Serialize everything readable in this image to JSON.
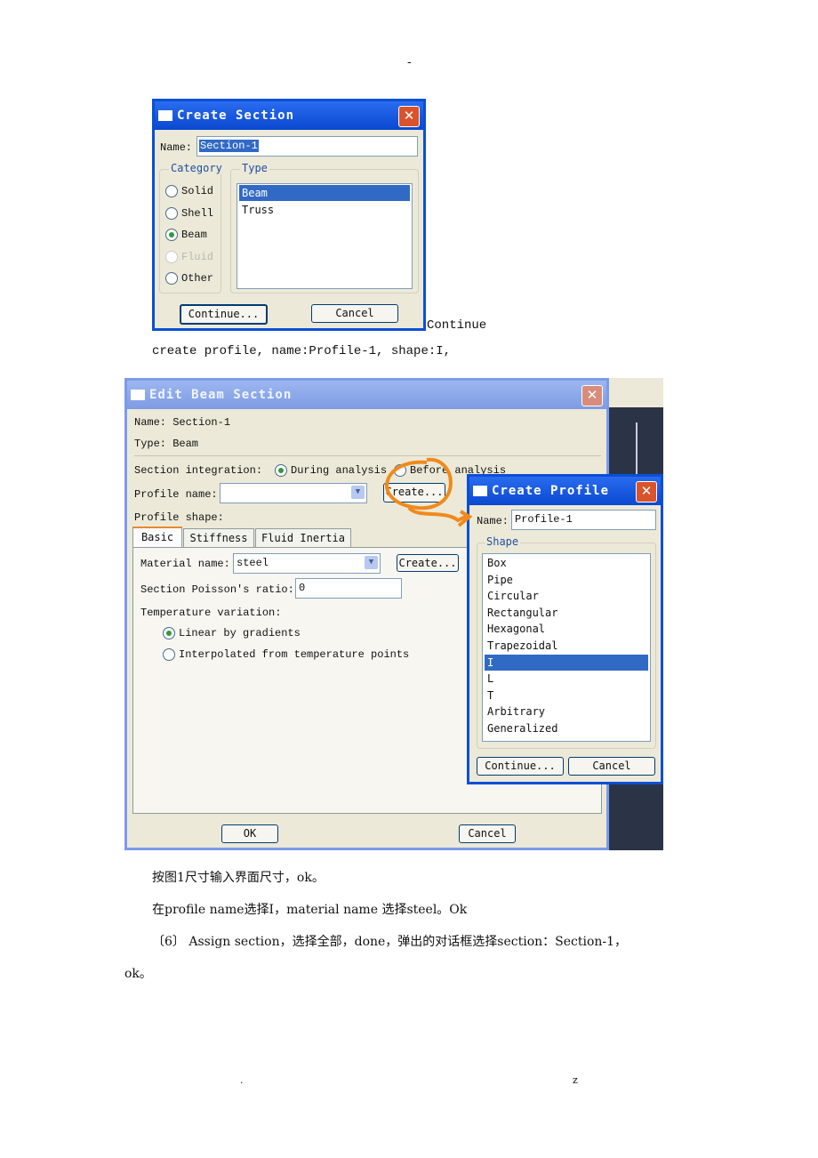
{
  "header": {
    "mark": "-"
  },
  "create_section": {
    "title": "Create Section",
    "name_label": "Name:",
    "name_value": "Section-1",
    "category_label": "Category",
    "categories": [
      {
        "label": "Solid",
        "selected": false,
        "enabled": true
      },
      {
        "label": "Shell",
        "selected": false,
        "enabled": true
      },
      {
        "label": "Beam",
        "selected": true,
        "enabled": true
      },
      {
        "label": "Fluid",
        "selected": false,
        "enabled": false
      },
      {
        "label": "Other",
        "selected": false,
        "enabled": true
      }
    ],
    "type_label": "Type",
    "types": [
      {
        "label": "Beam",
        "selected": true
      },
      {
        "label": "Truss",
        "selected": false
      }
    ],
    "continue_label": "Continue...",
    "cancel_label": "Cancel",
    "close_icon": "close-icon"
  },
  "caption_continue": "Continue",
  "line_create_profile": "create profile, name:Profile-1, shape:I,",
  "edit_beam": {
    "title": "Edit Beam Section",
    "name_line": "Name:  Section-1",
    "type_line": "Type:  Beam",
    "integration_label": "Section integration:",
    "integration_options": [
      {
        "label": "During analysis",
        "selected": true
      },
      {
        "label": "Before analysis",
        "selected": false
      }
    ],
    "profile_name_label": "Profile name:",
    "profile_name_value": "",
    "create_label": "Create...",
    "profile_shape_label": "Profile shape:",
    "tabs": [
      {
        "label": "Basic",
        "active": true
      },
      {
        "label": "Stiffness",
        "active": false
      },
      {
        "label": "Fluid Inertia",
        "active": false
      }
    ],
    "material_label": "Material name:",
    "material_value": "steel",
    "material_create_label": "Create...",
    "poisson_label": "Section Poisson's ratio:",
    "poisson_value": "0",
    "temp_label": "Temperature variation:",
    "temp_options": [
      {
        "label": "Linear by gradients",
        "selected": true
      },
      {
        "label": "Interpolated from temperature points",
        "selected": false
      }
    ],
    "ok_label": "OK",
    "cancel_label": "Cancel"
  },
  "create_profile": {
    "title": "Create Profile",
    "name_label": "Name:",
    "name_value": "Profile-1",
    "shape_label": "Shape",
    "shapes": [
      "Box",
      "Pipe",
      "Circular",
      "Rectangular",
      "Hexagonal",
      "Trapezoidal",
      "I",
      "L",
      "T",
      "Arbitrary",
      "Generalized"
    ],
    "selected_shape": "I",
    "continue_label": "Continue...",
    "cancel_label": "Cancel"
  },
  "annotation_color": "#f08a1c",
  "paragraphs": [
    "按图1尺寸输入界面尺寸，ok。",
    "在profile name选择I，material name 选择steel。Ok",
    "〔6〕 Assign section，选择全部，done，弹出的对话框选择section：Section-1，",
    "ok。"
  ],
  "footer": {
    "left": ".",
    "right": "z"
  }
}
